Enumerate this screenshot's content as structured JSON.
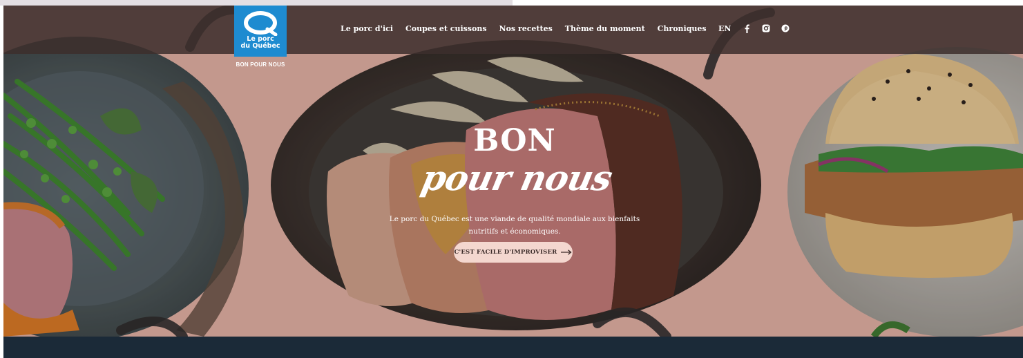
{
  "colors": {
    "hero_bg": "#e8b5a8",
    "navbar": "#3c2e2c",
    "logo_blue": "#1e8bd0",
    "cta_bg": "#f4d7cf",
    "footer": "#1b2a38"
  },
  "logo": {
    "line1": "Le porc",
    "line2": "du Québec",
    "tagline": "BON POUR NOUS",
    "icon": "q-logo-icon"
  },
  "nav": {
    "items": [
      {
        "label": "Le porc d'ici"
      },
      {
        "label": "Coupes et cuissons"
      },
      {
        "label": "Nos recettes"
      },
      {
        "label": "Thème du moment"
      },
      {
        "label": "Chroniques"
      }
    ],
    "lang": "EN",
    "social": [
      "facebook-icon",
      "instagram-icon",
      "pinterest-icon"
    ]
  },
  "hero": {
    "title": "BON",
    "script": "pour nous",
    "description": "Le porc du Québec est une viande de qualité mondiale aux bienfaits nutritifs et économiques.",
    "cta_label": "C'EST FACILE D'IMPROVISER"
  }
}
